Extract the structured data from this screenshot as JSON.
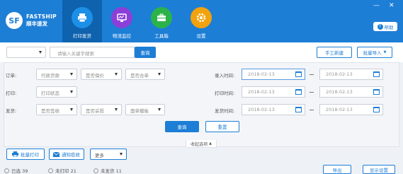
{
  "brand": {
    "logo_mark": "SF",
    "name_en": "FASTSHIP",
    "name_cn": "顺丰速发"
  },
  "nav": [
    {
      "label": "打印发货",
      "icon": "printer-icon",
      "color": "#1d8fe6"
    },
    {
      "label": "物流监控",
      "icon": "monitor-icon",
      "color": "#8b3fd9"
    },
    {
      "label": "工具箱",
      "icon": "toolbox-icon",
      "color": "#2bb34a"
    },
    {
      "label": "设置",
      "icon": "gear-icon",
      "color": "#f2a20c"
    }
  ],
  "window": {
    "minimize": "—",
    "close": "✕"
  },
  "help": {
    "label": "帮助",
    "glyph": "?"
  },
  "toolbar": {
    "search_placeholder": "请输入关键字搜索",
    "search_label": "查询",
    "manual_create": "手工新建",
    "batch_import": "批量导入"
  },
  "filters": {
    "order_label": "订单:",
    "print_label": "打印:",
    "ship_label": "发货:",
    "order_selects": [
      "代收货款",
      "是否保价",
      "是否合单"
    ],
    "print_selects": [
      "打印状态"
    ],
    "ship_selects": [
      "是否签收",
      "是否妥投",
      "面单模板"
    ],
    "record_time": "录入时间:",
    "print_time": "打印时间:",
    "ship_time": "发货时间:",
    "date_value": "2018-02-13",
    "query": "查询",
    "reset": "重置",
    "collapse": "收起选项"
  },
  "actions": {
    "batch_print": "批量打印",
    "notify_pickup": "通知揽收",
    "more": "更多"
  },
  "status": {
    "selected": "已选 39",
    "not_printed": "未打印 21",
    "not_shipped": "未发货 11"
  },
  "bottom": {
    "export": "导出",
    "display_settings": "显示设置"
  }
}
